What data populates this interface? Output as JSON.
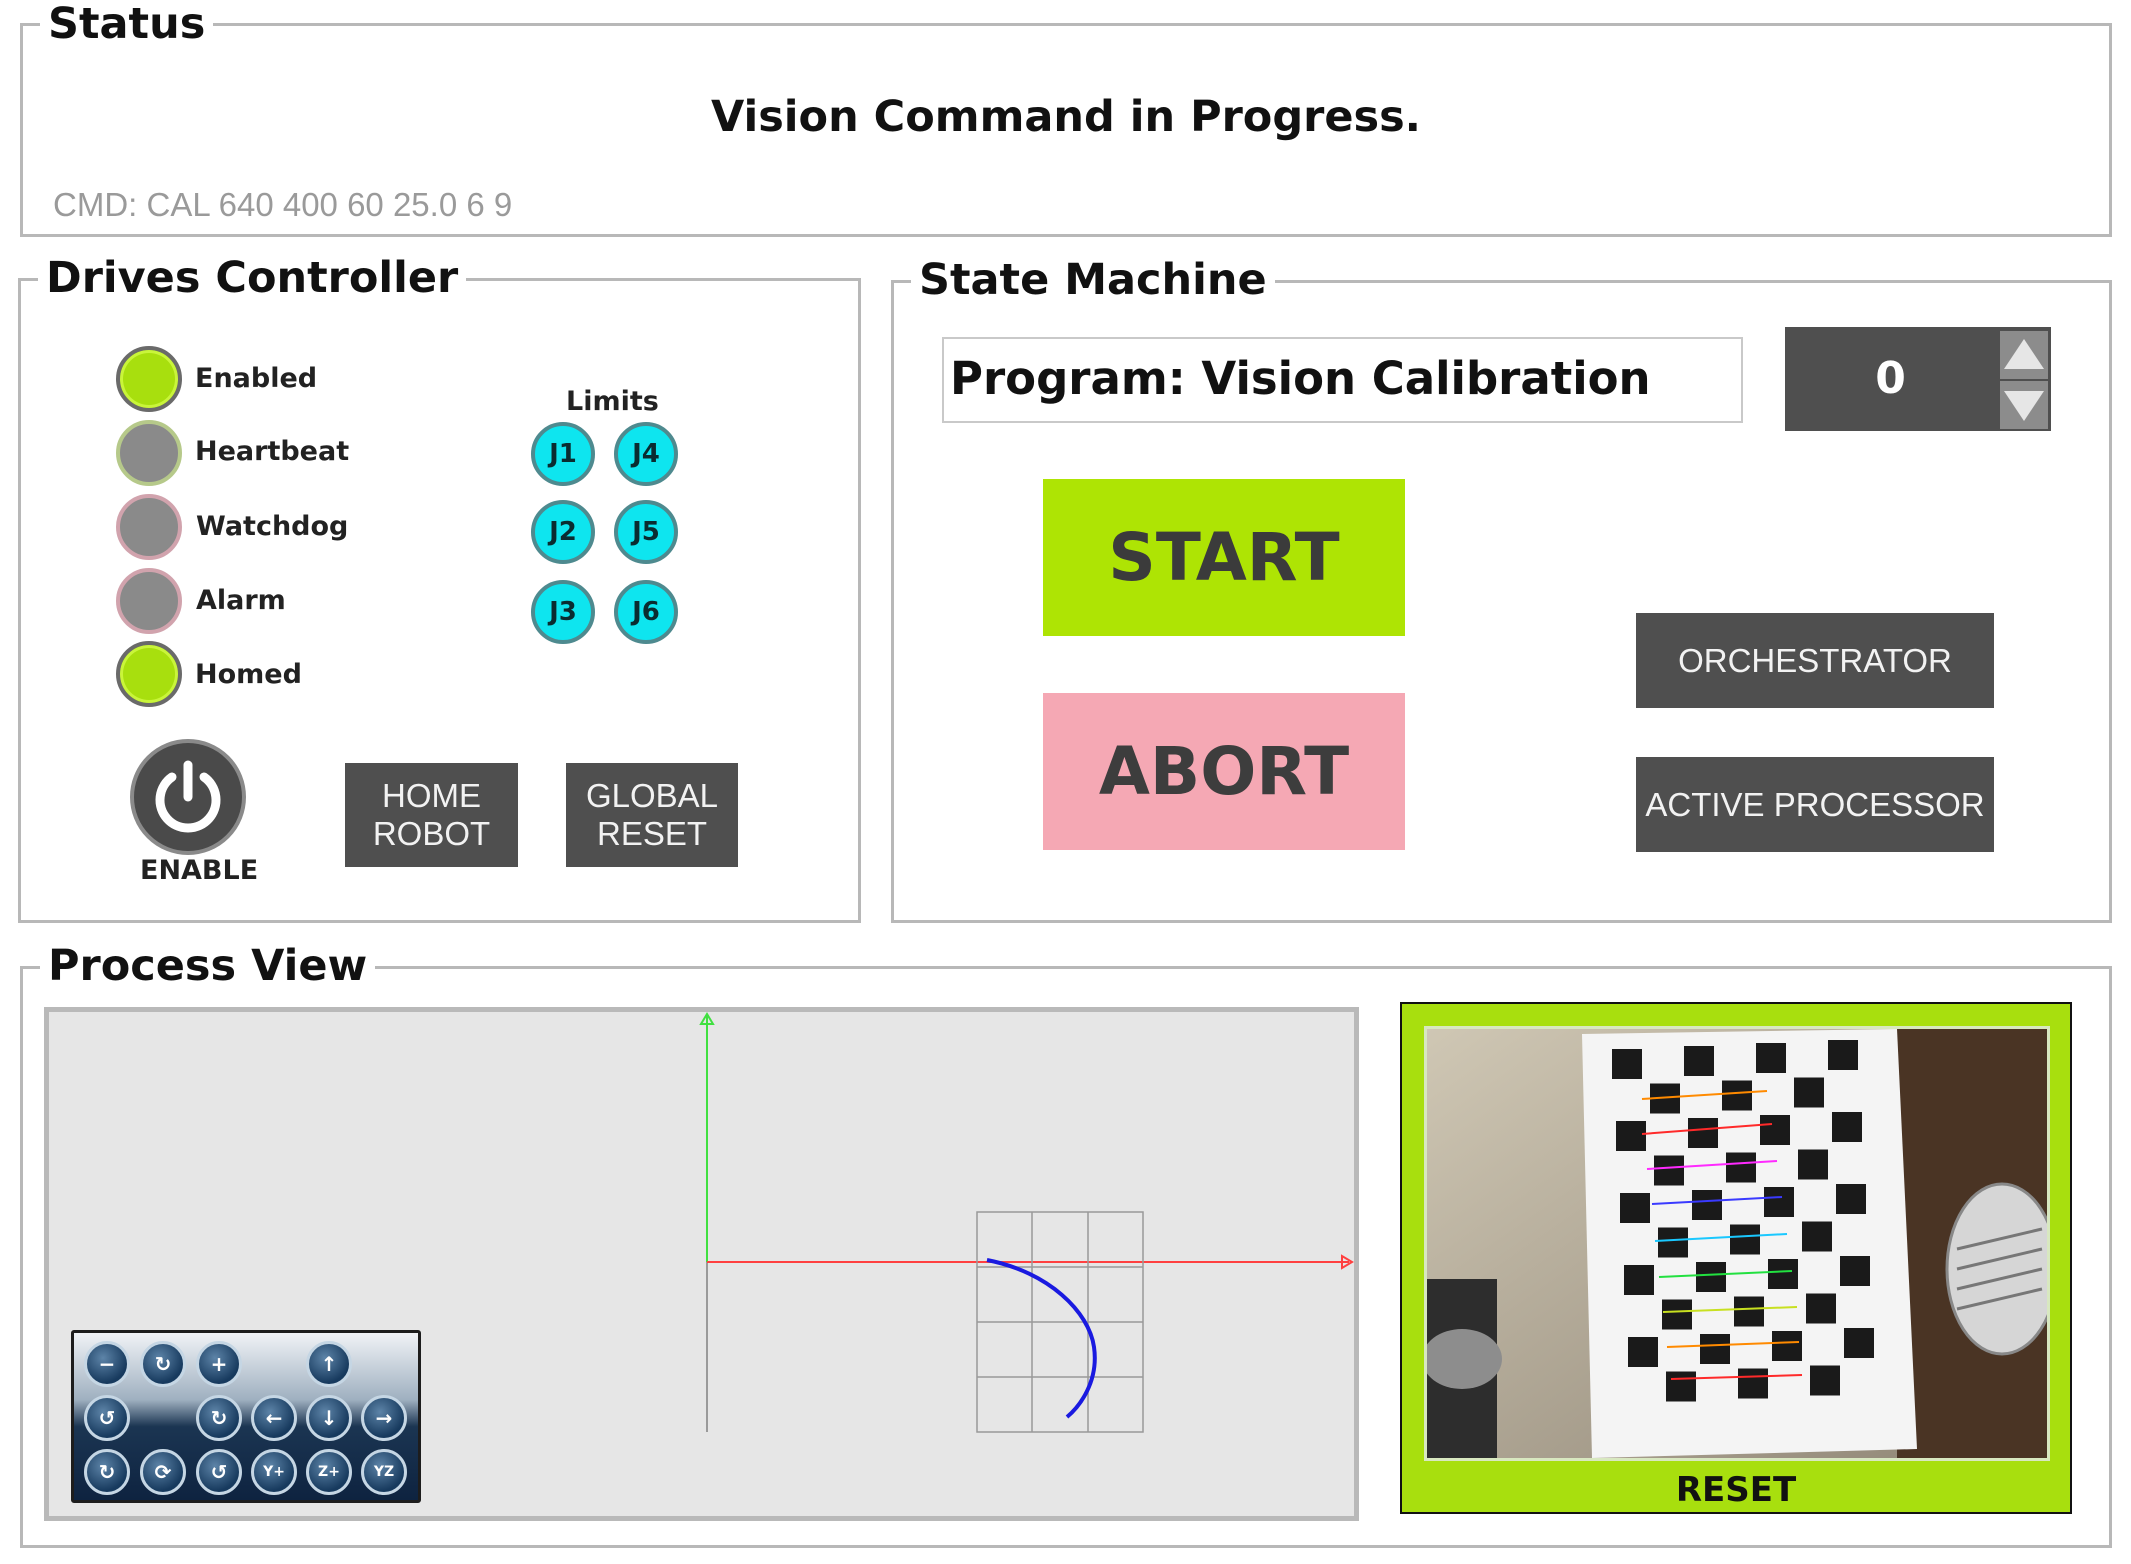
{
  "status": {
    "legend": "Status",
    "message": "Vision Command in Progress.",
    "command": "CMD: CAL 640 400 60 25.0 6 9"
  },
  "drives": {
    "legend": "Drives Controller",
    "indicators": [
      {
        "label": "Enabled",
        "state": "on"
      },
      {
        "label": "Heartbeat",
        "state": "off"
      },
      {
        "label": "Watchdog",
        "state": "off"
      },
      {
        "label": "Alarm",
        "state": "off"
      },
      {
        "label": "Homed",
        "state": "on"
      }
    ],
    "limits_label": "Limits",
    "limits": [
      "J1",
      "J4",
      "J2",
      "J5",
      "J3",
      "J6"
    ],
    "enable_label": "ENABLE",
    "home_robot_label": "HOME ROBOT",
    "global_reset_label": "GLOBAL RESET",
    "colors": {
      "on": "#a8df0e",
      "off": "#8a8a8a",
      "limit": "#0ee5ef"
    }
  },
  "state_machine": {
    "legend": "State Machine",
    "program": "Program: Vision Calibration",
    "step_value": "0",
    "start_label": "START",
    "abort_label": "ABORT",
    "orchestrator_label": "ORCHESTRATOR",
    "active_processor_label": "ACTIVE PROCESSOR",
    "colors": {
      "start": "#aee404",
      "abort": "#f5a8b4",
      "dark_button": "#4f4f4f"
    }
  },
  "process_view": {
    "legend": "Process View",
    "camera_reset_label": "RESET",
    "toolbar_icons": [
      "zoom-out-icon",
      "rotate-icon",
      "zoom-in-icon",
      "pan-up-icon",
      "rotate-left-icon",
      "rotate-right-icon",
      "pan-left-icon",
      "pan-down-icon",
      "pan-right-icon",
      "reset-view-icon",
      "orbit-icon",
      "undo-rotate-icon",
      "view-yx-icon",
      "view-zx-icon",
      "view-yz-icon"
    ],
    "axis_colors": {
      "x": "#ff4040",
      "y": "#40e040",
      "z": "#9a9a9a",
      "path": "#1a1ae0"
    }
  }
}
